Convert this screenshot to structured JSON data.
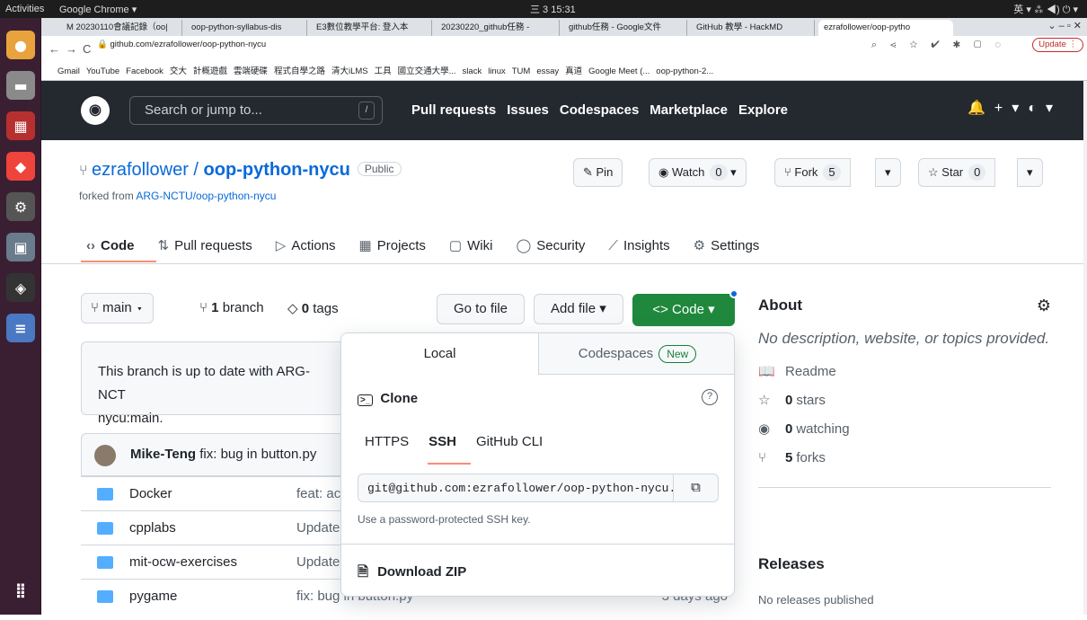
{
  "os": {
    "activities": "Activities",
    "app_menu": "Google Chrome ▾",
    "clock": "三 3 15:31",
    "tray": "英 ▾   ⁂ ◀) ⏻ ▾"
  },
  "dock": [
    {
      "name": "chrome",
      "glyph": "●",
      "color": "#e8a33d"
    },
    {
      "name": "files",
      "glyph": "▬",
      "color": "#8a8a8a"
    },
    {
      "name": "app-red",
      "glyph": "▦",
      "color": "#b73030"
    },
    {
      "name": "anydesk",
      "glyph": "◆",
      "color": "#ef443b"
    },
    {
      "name": "settings",
      "glyph": "⚙",
      "color": "#555"
    },
    {
      "name": "video",
      "glyph": "▣",
      "color": "#6a7b8c"
    },
    {
      "name": "unity",
      "glyph": "◈",
      "color": "#333"
    },
    {
      "name": "doc",
      "glyph": "≡",
      "color": "#4a78c2"
    }
  ],
  "browser": {
    "tabs": [
      "M 20230110會議記錄（oo|",
      "oop-python-syllabus-dis",
      "E3數位教學平台: 登入本",
      "20230220_github任務 -",
      "github任務 - Google文件",
      "GitHub 教學 - HackMD",
      "ezrafollower/oop-pytho"
    ],
    "url": "github.com/ezrafollower/oop-python-nycu",
    "update_label": "Update ⋮",
    "bookmarks": [
      "Gmail",
      "YouTube",
      "Facebook",
      "交大",
      "計概遊戲",
      "雲端硬碟",
      "程式自學之路",
      "清大iLMS",
      "工具",
      "國立交通大學...",
      "slack",
      "linux",
      "TUM",
      "essay",
      "真道",
      "Google Meet (...",
      "oop-python-2..."
    ]
  },
  "github": {
    "search_placeholder": "Search or jump to...",
    "slash": "/",
    "nav": [
      "Pull requests",
      "Issues",
      "Codespaces",
      "Marketplace",
      "Explore"
    ],
    "repo_owner": "ezrafollower",
    "repo_sep": " / ",
    "repo_name": "oop-python-nycu",
    "visibility": "Public",
    "forked_prefix": "forked from ",
    "forked_source": "ARG-NCTU/oop-python-nycu",
    "pin": "Pin",
    "watch": "Watch",
    "watch_count": "0",
    "fork": "Fork",
    "fork_count": "5",
    "star": "Star",
    "star_count": "0",
    "repo_tabs": [
      "Code",
      "Pull requests",
      "Actions",
      "Projects",
      "Wiki",
      "Security",
      "Insights",
      "Settings"
    ],
    "branch_name": "main",
    "branch_count": "1",
    "branch_word": "branch",
    "tag_count": "0",
    "tag_word": "tags",
    "go_to_file": "Go to file",
    "add_file": "Add file ▾",
    "code_button": "<> Code ▾",
    "sync_message": "This branch is up to date with ARG-NCT",
    "sync_message2": "nycu:main.",
    "commit_author": "Mike-Teng",
    "commit_msg": " fix: bug in button.py",
    "files": [
      {
        "name": "Docker",
        "msg": "feat: ac",
        "date": ""
      },
      {
        "name": "cpplabs",
        "msg": "Update",
        "date": ""
      },
      {
        "name": "mit-ocw-exercises",
        "msg": "Update",
        "date": ""
      },
      {
        "name": "pygame",
        "msg": "fix: bug in button.py",
        "date": "3 days ago"
      }
    ],
    "about_title": "About",
    "about_desc": "No description, website, or topics provided.",
    "readme": "Readme",
    "stars_count": "0",
    "stars_word": "stars",
    "watching_count": "0",
    "watching_word": "watching",
    "forks_count": "5",
    "forks_word": "forks",
    "releases_title": "Releases",
    "no_releases": "No releases published"
  },
  "clone_popup": {
    "tab_local": "Local",
    "tab_codespaces": "Codespaces",
    "new_badge": "New",
    "clone_title": "Clone",
    "protocols": [
      "HTTPS",
      "SSH",
      "GitHub CLI"
    ],
    "ssh_url": "git@github.com:ezrafollower/oop-python-nycu.git",
    "hint": "Use a password-protected SSH key.",
    "download_zip": "Download ZIP"
  }
}
